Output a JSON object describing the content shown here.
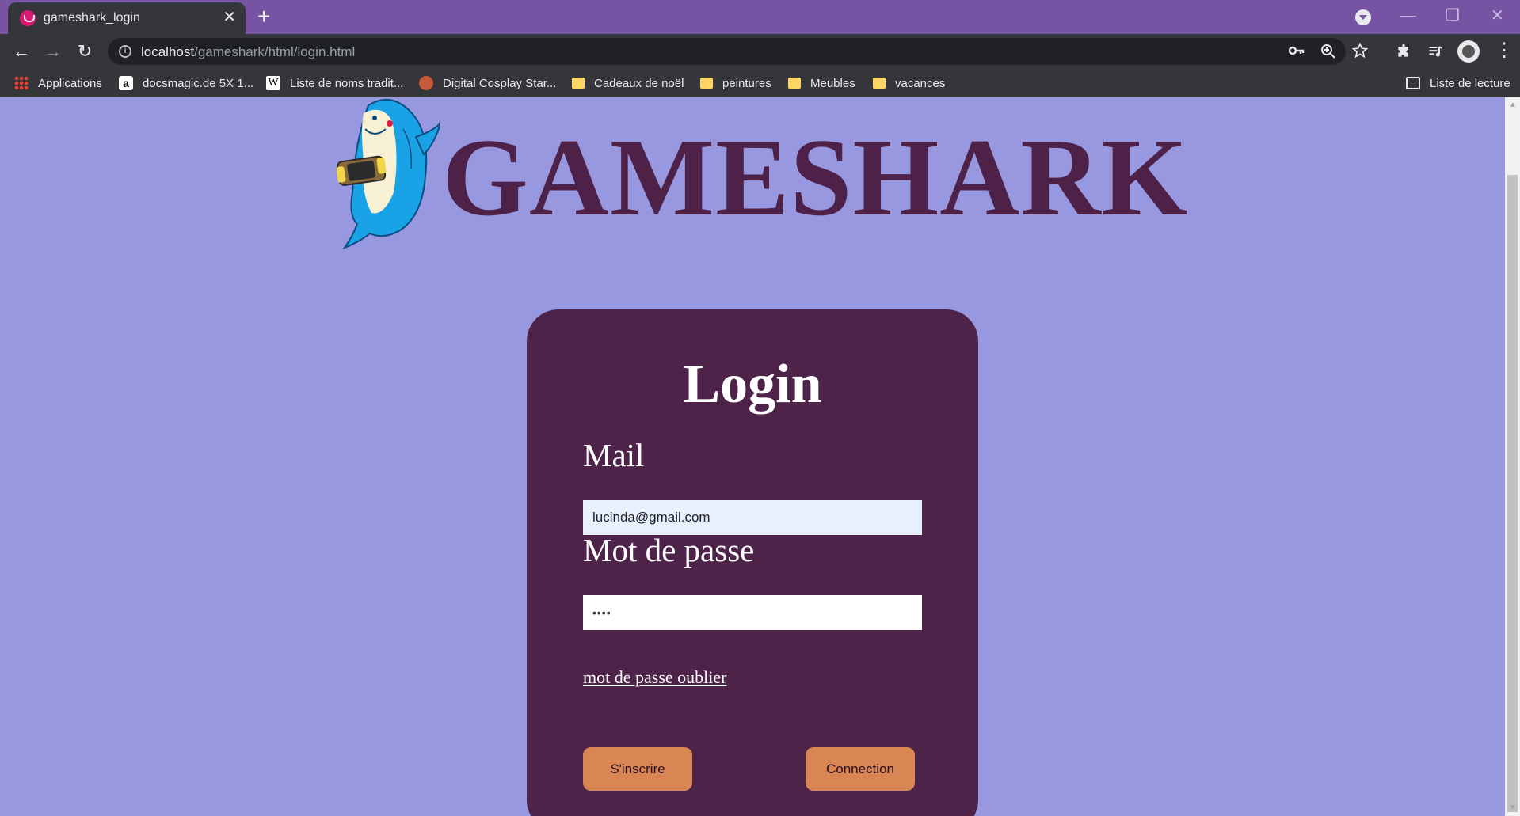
{
  "browser": {
    "tab_title": "gameshark_login",
    "tab_close": "✕",
    "new_tab": "+",
    "url_host": "localhost",
    "url_path": "/gameshark/html/login.html",
    "info_glyph": "i",
    "window_controls": {
      "minimize": "—",
      "restore": "❐",
      "close": "✕"
    },
    "toolbar": {
      "back": "←",
      "forward": "→",
      "reload": "↻"
    },
    "omnibox_icons": [
      "key-icon",
      "zoom-icon",
      "star-icon"
    ],
    "right_icons": [
      "extensions-icon",
      "media-control-icon",
      "profile-icon",
      "menu-icon"
    ],
    "bookmarks": [
      {
        "label": "Applications",
        "icon": "apps-icon"
      },
      {
        "label": "docsmagic.de 5X 1...",
        "icon": "amazon-icon",
        "glyph": "a"
      },
      {
        "label": "Liste de noms tradit...",
        "icon": "wikipedia-icon",
        "glyph": "W"
      },
      {
        "label": "Digital Cosplay Star...",
        "icon": "avatar-icon"
      },
      {
        "label": "Cadeaux de noël",
        "icon": "folder-icon"
      },
      {
        "label": "peintures",
        "icon": "folder-icon"
      },
      {
        "label": "Meubles",
        "icon": "folder-icon"
      },
      {
        "label": "vacances",
        "icon": "folder-icon"
      }
    ],
    "reading_list": "Liste de lecture"
  },
  "page": {
    "brand": "GAMESHARK",
    "logo_icon": "shark-with-console-icon",
    "background_color": "#9898e0",
    "card_color": "#4e2349",
    "button_color": "#d98654",
    "login": {
      "title": "Login",
      "mail_label": "Mail",
      "mail_value": "lucinda@gmail.com",
      "password_label": "Mot de passe",
      "password_value": "••••",
      "forgot_link": "mot de passe oublier",
      "signup_button": "S'inscrire",
      "login_button": "Connection"
    }
  }
}
